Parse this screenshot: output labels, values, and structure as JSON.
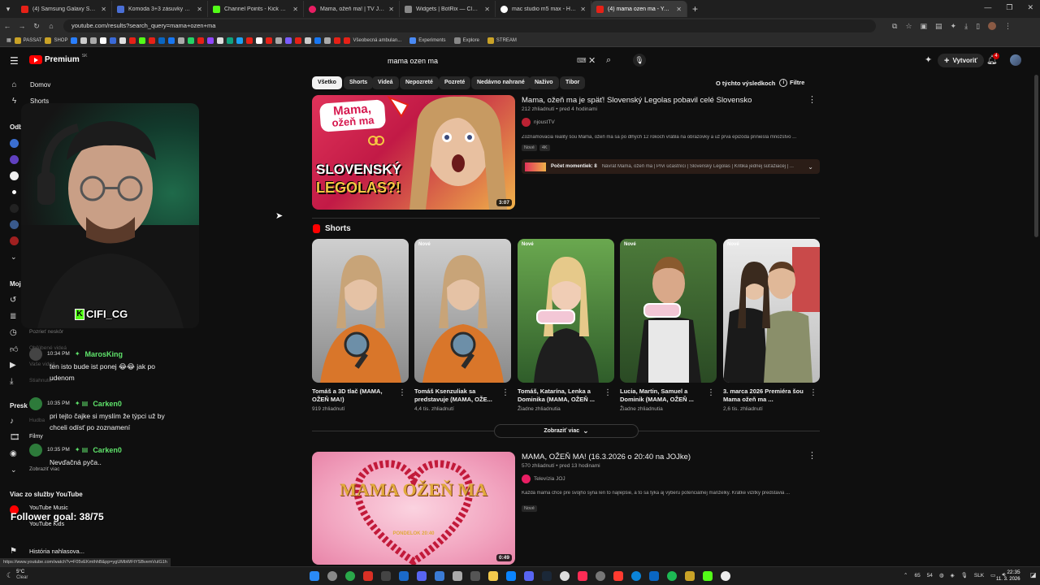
{
  "browser": {
    "tabs": [
      {
        "label": "(4) Samsung Galaxy S26 Ultra Li",
        "color": "#e62117"
      },
      {
        "label": "Komoda 3+3 zásuvky TANGE b",
        "color": "#4a6fd6"
      },
      {
        "label": "Channel Points - Kick Dashboar",
        "color": "#53fc18"
      },
      {
        "label": "Mama, ožeň ma! | TV JOJ",
        "color": "#e91e63"
      },
      {
        "label": "Widgets | BotRix — Cloud Strea",
        "color": "#888888"
      },
      {
        "label": "mac studio m5 max - Hľadať G",
        "color": "#ffffff"
      },
      {
        "label": "(4) mama ozen ma - YouTube",
        "color": "#e62117"
      }
    ],
    "url": "youtube.com/results?search_query=mama+ozen+ma",
    "bookmarks": [
      "PASSAT",
      "SHOP",
      "Všeobecná ambulan...",
      "Experiments",
      "Explore",
      "STREAM"
    ],
    "status_url": "https://www.youtube.com/watch?v=F05vEKmthhB&pp=ygUMbWFtYSBvemVuIG1h"
  },
  "youtube": {
    "logo": "Premium",
    "logo_badge": "SK",
    "search_value": "mama ozen ma",
    "create_label": "Vytvoriť",
    "notif_count": "4",
    "chips": [
      "Všetko",
      "Shorts",
      "Videá",
      "Nepozreté",
      "Pozreté",
      "Nedávno nahrané",
      "Naživo",
      "Tibor"
    ],
    "about_results": "O týchto výsledkoch",
    "filters": "Filtre"
  },
  "sidebar": {
    "home": "Domov",
    "shorts": "Shorts",
    "subs_heading": "Odb",
    "you_heading": "Moj",
    "explore_heading": "Presk",
    "history_item": "Pozrieť neskôr",
    "liked_item": "Obľúbené videá",
    "yours_item": "Vaše videá",
    "downloads_item": "Stiahnuté",
    "music_item": "Hudba",
    "movies_item": "Filmy",
    "more_item": "Zobraziť viac",
    "more_heading": "Viac zo služby YouTube",
    "yt_music": "YouTube Music",
    "yt_kids": "YouTube Kids",
    "report_history": "História nahlasova..."
  },
  "overlay": {
    "streamer_tag": "CIFI_CG",
    "follower_goal": "Follower goal: 38/75",
    "chat": [
      {
        "time": "10:34 PM",
        "name": "MarosKing",
        "text1": "ten isto bude ist ponej 😂😂 jak po",
        "text2": "udenom"
      },
      {
        "time": "10:35 PM",
        "name": "Carken0",
        "text1": "pri tejto čajke si myslím že týpci už by",
        "text2": "chceli odísť po zoznamení"
      },
      {
        "time": "10:35 PM",
        "name": "Carken0",
        "text1": "Nevďačná pyča..",
        "text2": ""
      }
    ]
  },
  "results": {
    "video1": {
      "title": "Mama, ožeň ma je späť! Slovenský Legolas pobavil celé Slovensko",
      "meta": "212 zhliadnutí • pred 4 hodinami",
      "channel": "njoustTV",
      "desc": "Zoznamovacia reality šou Mama, ožeň ma sa po dlhých 12 rokoch vrátila na obrazovky a už prvá epizóda priniesla množstvo ...",
      "badge1": "Nové",
      "badge2": "4K",
      "moments": "Počet momentiek: 8",
      "moments_text": "Návrat Mama, ožeň ma | Prví účastníci | Slovenský Legolas | Kritika jednej súťažiacej | ...",
      "duration": "3:07",
      "thumb_line1": "Mama,",
      "thumb_line2": "ožeň ma",
      "thumb_line3": "SLOVENSKÝ",
      "thumb_line4": "LEGOLAS?!"
    },
    "shorts_heading": "Shorts",
    "shorts": [
      {
        "title": "Tomáš a 3D tlač (MAMA, OŽEŇ MA!)",
        "views": "919 zhliadnutí",
        "new": ""
      },
      {
        "title": "Tomáš Ksenzuliak sa predstavuje (MAMA, OŽE...",
        "views": "4,4 tis. zhliadnutí",
        "new": "Nové"
      },
      {
        "title": "Tomáš, Katarína, Lenka a Dominika (MAMA, OŽEŇ ...",
        "views": "Žiadne zhliadnutia",
        "new": "Nové"
      },
      {
        "title": "Lucia, Martin, Samuel a Dominik (MAMA, OŽEŇ ...",
        "views": "Žiadne zhliadnutia",
        "new": "Nové"
      },
      {
        "title": "3. marca 2026 Premiéra šou Mama ožeň ma ...",
        "views": "2,6 tis. zhliadnutí",
        "new": "Nové"
      }
    ],
    "show_more": "Zobraziť viac",
    "video2": {
      "title": "MAMA, OŽEŇ MA! (16.3.2026 o 20:40 na JOJke)",
      "meta": "570 zhliadnutí • pred 13 hodinami",
      "channel": "Televízia JOJ",
      "desc": "Každá mama chce pre svojho syna len to najlepšie, a to sa týka aj výberu potenciálnej manželky. Krátke vizitky predstavia ...",
      "badge1": "Nové",
      "duration": "0:49",
      "thumb_title": "MAMA OŽEŇ MA",
      "thumb_sub": "PONDELOK 20:40"
    }
  },
  "taskbar": {
    "weather_temp": "5°C",
    "weather_text": "Clear",
    "tray1": "65",
    "tray2": "54",
    "lang": "SLK",
    "time": "22:35",
    "date": "11. 3. 2026"
  }
}
